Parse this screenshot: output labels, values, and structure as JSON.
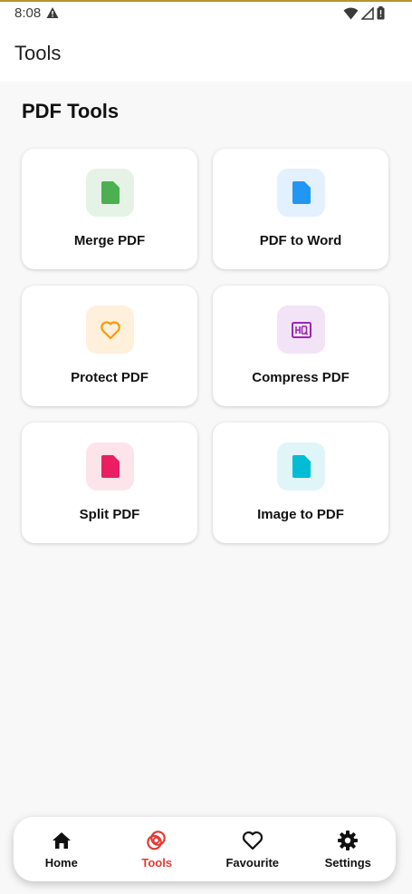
{
  "status": {
    "time": "8:08"
  },
  "appbar": {
    "title": "Tools"
  },
  "section": {
    "title": "PDF Tools"
  },
  "tools": [
    {
      "label": "Merge PDF",
      "icon": "file-icon",
      "color": "#4caf50",
      "bg": "#e5f3e6"
    },
    {
      "label": "PDF to Word",
      "icon": "file-icon",
      "color": "#2196f3",
      "bg": "#e3f0fd"
    },
    {
      "label": "Protect PDF",
      "icon": "heart-icon",
      "color": "#ff9800",
      "bg": "#fff0dc"
    },
    {
      "label": "Compress PDF",
      "icon": "hq-icon",
      "color": "#9c27b0",
      "bg": "#f3e3f6"
    },
    {
      "label": "Split PDF",
      "icon": "file-icon",
      "color": "#e91e63",
      "bg": "#fde4eb"
    },
    {
      "label": "Image to PDF",
      "icon": "file-icon",
      "color": "#00bcd4",
      "bg": "#dff5f8"
    }
  ],
  "nav": {
    "active_color": "#e53935",
    "items": [
      {
        "label": "Home",
        "icon": "home-icon"
      },
      {
        "label": "Tools",
        "icon": "rings-icon"
      },
      {
        "label": "Favourite",
        "icon": "heart-outline-icon"
      },
      {
        "label": "Settings",
        "icon": "gear-icon"
      }
    ]
  }
}
